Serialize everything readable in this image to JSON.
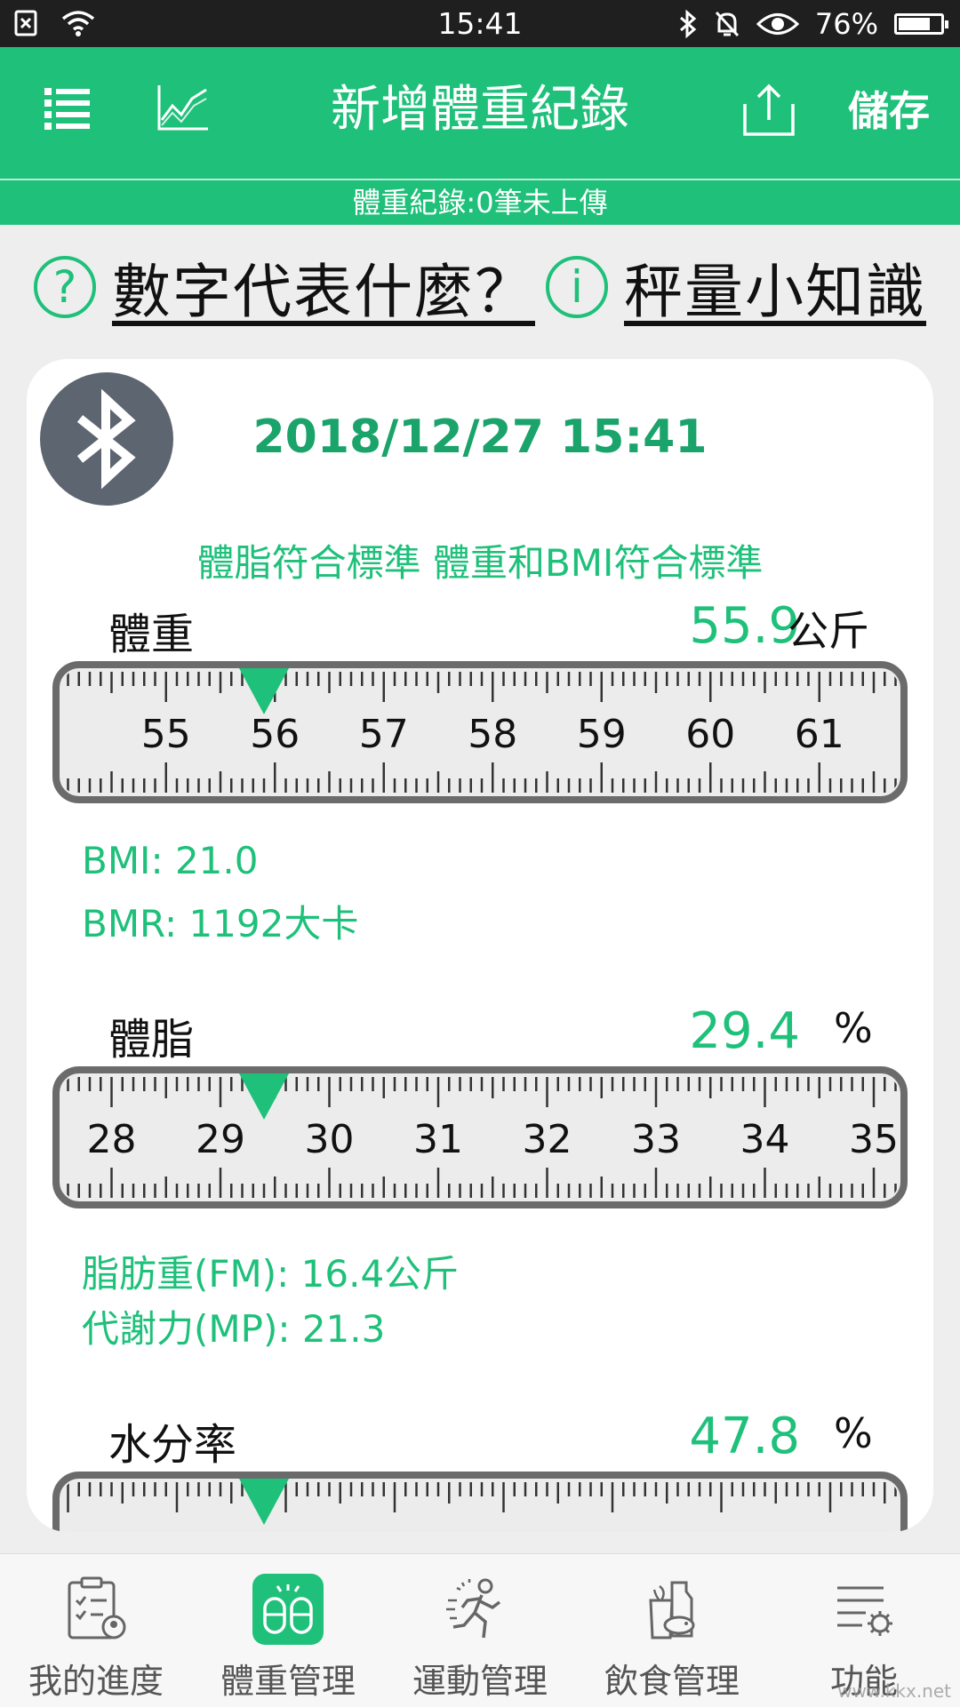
{
  "status_bar": {
    "time": "15:41",
    "battery": "76%",
    "battery_level": 0.76
  },
  "toolbar": {
    "title": "新增體重紀錄",
    "save_label": "儲存",
    "sub_status": "體重紀錄:0筆未上傳"
  },
  "help": {
    "what_numbers": "數字代表什麼？",
    "knowledge": "秤量小知識",
    "question_glyph": "?",
    "info_glyph": "i"
  },
  "record": {
    "datetime": "2018/12/27 15:41",
    "status_text": "體脂符合標準  體重和BMI符合標準"
  },
  "weight": {
    "label": "體重",
    "value": "55.9",
    "unit": "公斤",
    "ruler_ticks": [
      55,
      56,
      57,
      58,
      59,
      60
    ],
    "ruler_value": 55.9,
    "bmi": "BMI: 21.0",
    "bmr": "BMR: 1192大卡"
  },
  "bodyfat": {
    "label": "體脂",
    "value": "29.4",
    "unit": "%",
    "ruler_ticks": [
      28,
      29,
      30,
      31,
      32,
      33,
      34
    ],
    "ruler_value": 29.4,
    "fm": "脂肪重(FM): 16.4公斤",
    "mp": "代謝力(MP): 21.3"
  },
  "water": {
    "label": "水分率",
    "value": "47.8",
    "unit": "%",
    "ruler_value": 47.8
  },
  "nav": {
    "items": [
      {
        "label": "我的進度",
        "icon": "progress-clipboard-icon"
      },
      {
        "label": "體重管理",
        "icon": "scale-feet-icon"
      },
      {
        "label": "運動管理",
        "icon": "running-person-icon"
      },
      {
        "label": "飲食管理",
        "icon": "food-groceries-icon"
      },
      {
        "label": "功能",
        "icon": "settings-list-icon"
      }
    ],
    "active_index": 1
  },
  "watermark": "www.kkx.net",
  "colors": {
    "brand_green": "#1ec07a",
    "dark_green_text": "#1aa36a",
    "bluetooth_bg": "#5d6570"
  }
}
